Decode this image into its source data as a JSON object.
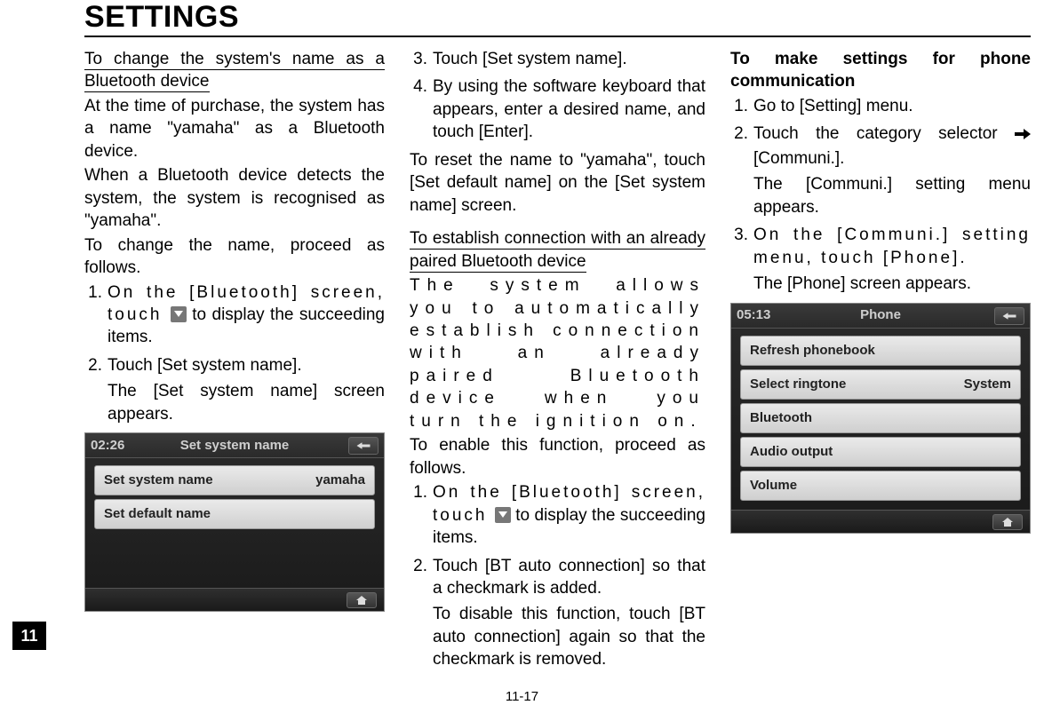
{
  "header": {
    "title": "SETTINGS"
  },
  "page_tab": "11",
  "footer": "11-17",
  "col1": {
    "subhead": "To change the system's name as a Bluetooth device",
    "p1": "At the time of purchase, the system has a name \"yamaha\" as a Bluetooth device.",
    "p2": "When a Bluetooth device detects the system, the system is recognised as \"yamaha\".",
    "p3": "To change the name, proceed as follows.",
    "li1_pre": "On the [Bluetooth] screen, touch ",
    "li1_post": " to display the succeeding items.",
    "li2": "Touch [Set system name].",
    "li2_sub": "The [Set system name] screen appears."
  },
  "fig1": {
    "clock": "02:26",
    "title": "Set system name",
    "row1_label": "Set system name",
    "row1_value": "yamaha",
    "row2_label": "Set default name"
  },
  "col2": {
    "li3": "Touch [Set system name].",
    "li4": "By using the software keyboard that appears, enter a desired name, and touch [Enter].",
    "p_reset": "To reset the name to \"yamaha\", touch [Set default name] on the [Set system name] screen.",
    "subhead2": "To establish connection with an already paired Bluetooth device",
    "p_sys": "The system allows you to automatically establish connection with an already paired Bluetooth device when you turn the ignition on.",
    "p_enable": "To enable this function, proceed as follows.",
    "li1_pre": "On the [Bluetooth] screen, touch ",
    "li1_post": " to display the succeeding items.",
    "li2": "Touch [BT auto connection] so that a checkmark is added.",
    "li2_sub": "To disable this function, touch [BT auto connection] again so that the checkmark is removed."
  },
  "col3": {
    "heading": "To make settings for phone communication",
    "li1": "Go to [Setting] menu.",
    "li2_pre": "Touch the category selector ",
    "li2_post": " [Communi.].",
    "li2_sub": "The [Communi.] setting menu appears.",
    "li3": "On the [Communi.] setting menu, touch [Phone].",
    "li3_sub": "The [Phone] screen appears."
  },
  "fig2": {
    "clock": "05:13",
    "title": "Phone",
    "rows": [
      {
        "label": "Refresh phonebook",
        "value": ""
      },
      {
        "label": "Select ringtone",
        "value": "System"
      },
      {
        "label": "Bluetooth",
        "value": ""
      },
      {
        "label": "Audio output",
        "value": ""
      },
      {
        "label": "Volume",
        "value": ""
      }
    ]
  }
}
